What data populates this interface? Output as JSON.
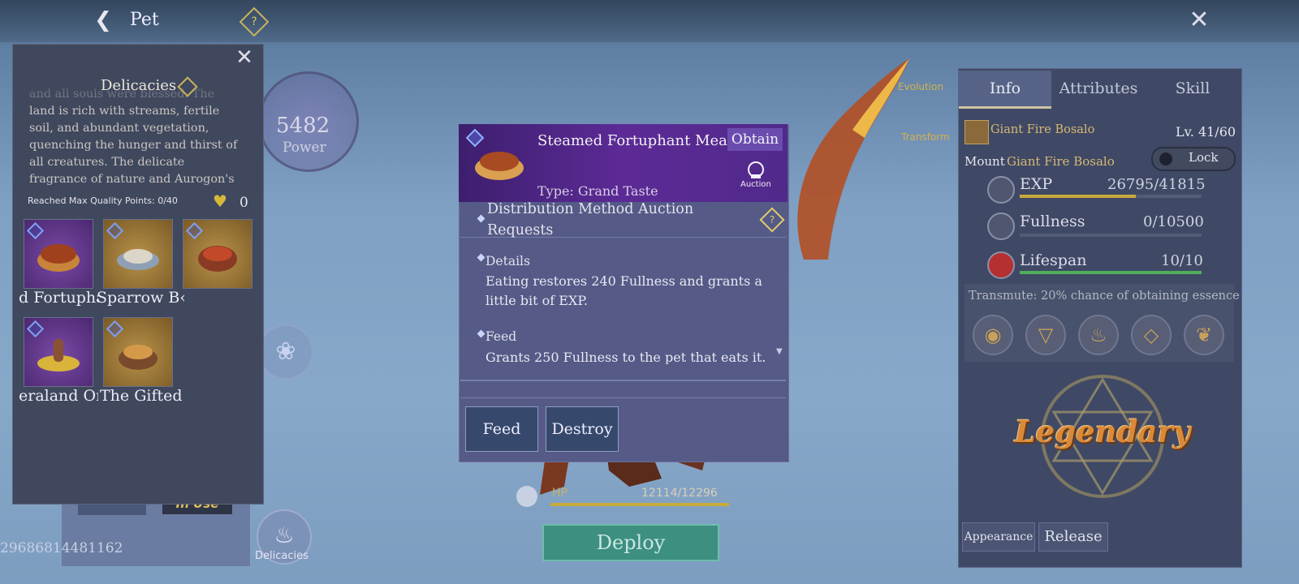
{
  "topbar": {
    "back_icon": "arrow-left-icon",
    "title": "Pet",
    "help_icon": "question-diamond-icon",
    "close_icon": "close-x-icon"
  },
  "background": {
    "power_value": "5482",
    "power_label": "Power",
    "evolution_label": "Evolution",
    "transform_label": "Transform",
    "in_use_label": "In Use",
    "serial": "29686814481162",
    "delicacies_button_label": "Delicacies",
    "hp_label": "HP",
    "hp_value": "12114/12296",
    "deploy_label": "Deploy"
  },
  "delicacies_panel": {
    "title": "Delicacies",
    "description": "and all souls were blessed. The land is rich with streams, fertile soil, and abundant vegetation, quenching the hunger and thirst of all creatures. The delicate fragrance of nature and Aurogon's benevolence fill the",
    "quality_label": "Reached Max Quality Points: 0/40",
    "heart_count": "0",
    "items": [
      {
        "name": "d Fortupha",
        "rarity": "purple"
      },
      {
        "name": "Sparrow B‹ypot",
        "rarity": "gold"
      },
      {
        "name": "",
        "rarity": "gold"
      },
      {
        "name": "eraland Or",
        "rarity": "purple"
      },
      {
        "name": "The Gifted",
        "rarity": "gold"
      }
    ]
  },
  "item_detail": {
    "name": "Steamed Fortuphant Meat",
    "obtain_label": "Obtain",
    "type": "Type: Grand Taste",
    "auction_label": "Auction",
    "distribution": "Distribution Method    Auction Requests",
    "details_title": "Details",
    "details_text": "Eating restores 240 Fullness and grants a little bit of EXP.",
    "feed_title": "Feed",
    "feed_text": "Grants 250 Fullness to the pet that eats it.",
    "feed_button": "Feed",
    "destroy_button": "Destroy"
  },
  "info_panel": {
    "tabs": [
      "Info",
      "Attributes",
      "Skill"
    ],
    "active_tab": "Info",
    "pet_name": "Giant Fire Bosalo",
    "level": "Lv. 41/60",
    "mount_label": "Mount",
    "mount_name": "Giant Fire Bosalo",
    "lock_label": "Lock",
    "stats": [
      {
        "name": "EXP",
        "value": "26795/41815",
        "fill": 0.64,
        "color": "#c9a83c",
        "icon": "exp-swirl-icon"
      },
      {
        "name": "Fullness",
        "value": "0/10500",
        "fill": 0.0,
        "color": "#8ab0d8",
        "icon": "stomach-icon"
      },
      {
        "name": "Lifespan",
        "value": "10/10",
        "fill": 1.0,
        "color": "#4fae5a",
        "icon": "heart-icon"
      }
    ],
    "transmute_label": "Transmute: 20% chance of obtaining essence",
    "runes": [
      "eye-rune-icon",
      "triangle-rune-icon",
      "flame-rune-icon",
      "square-rune-icon",
      "leaf-rune-icon"
    ],
    "rarity_label": "Legendary",
    "appearance_button": "Appearance",
    "release_button": "Release"
  }
}
